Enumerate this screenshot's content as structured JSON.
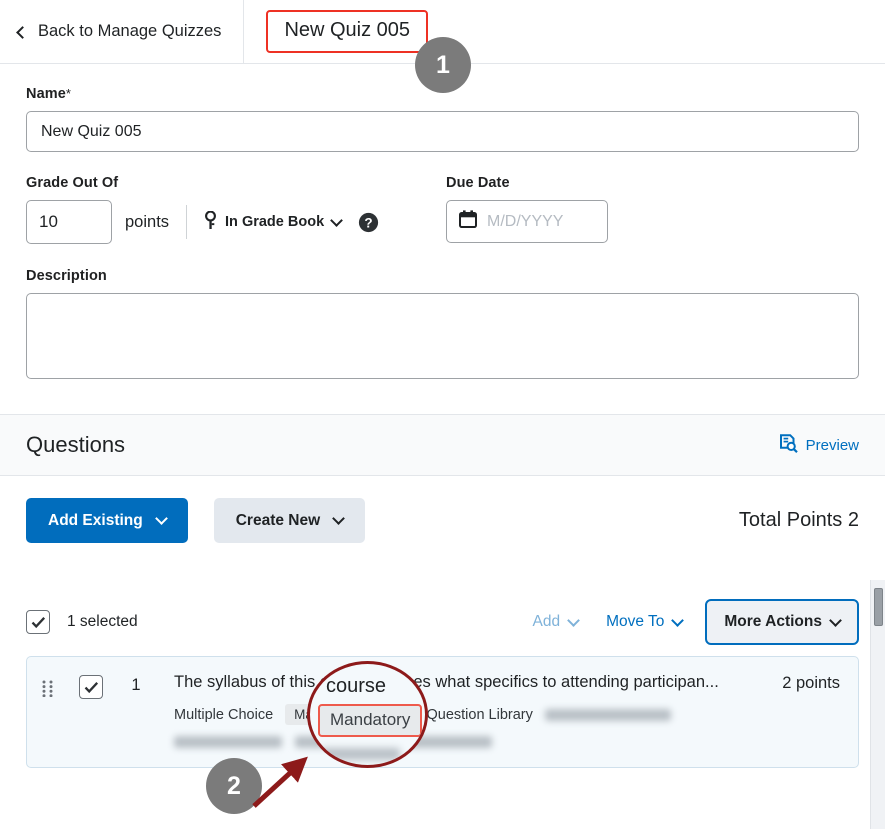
{
  "topbar": {
    "back_label": "Back to Manage Quizzes",
    "back_icon": "chevron-left-icon",
    "quiz_tab_label": "New Quiz 005"
  },
  "form": {
    "name": {
      "label": "Name",
      "required_mark": "*",
      "value": "New Quiz 005"
    },
    "grade_out_of": {
      "label": "Grade Out Of",
      "value": "10",
      "unit": "points",
      "gradebook_icon": "key-icon",
      "gradebook_label": "In Grade Book",
      "gradebook_caret": "chevron-down-icon",
      "help_icon": "help-circle-icon"
    },
    "due_date": {
      "label": "Due Date",
      "icon": "calendar-icon",
      "placeholder": "M/D/YYYY",
      "value": ""
    },
    "description": {
      "label": "Description",
      "value": ""
    }
  },
  "questions": {
    "section_title": "Questions",
    "preview_label": "Preview",
    "preview_icon": "document-search-icon",
    "add_existing_label": "Add Existing",
    "create_new_label": "Create New",
    "total_points_label": "Total Points 2",
    "selection": {
      "checkbox_icon": "checkmark-icon",
      "selected_label": "1 selected",
      "add_label": "Add",
      "move_to_label": "Move To",
      "more_actions_label": "More Actions"
    },
    "rows": [
      {
        "drag_icon": "drag-handle-icon",
        "checkbox_icon": "checkmark-icon",
        "number": "1",
        "text": "The syllabus of this course outlines what specifics to attending participan...",
        "type": "Multiple Choice",
        "mandatory_pill": "Mandatory",
        "library_label": "Also in Question Library",
        "points": "2 points"
      }
    ]
  },
  "annotations": {
    "badge_one": "1",
    "badge_two": "2",
    "lens_word": "course",
    "lens_pill": "Mandatory",
    "highlight_color": "#ee3124",
    "circle_color": "#8d1a1a",
    "badge_color": "#7b7b7b"
  }
}
